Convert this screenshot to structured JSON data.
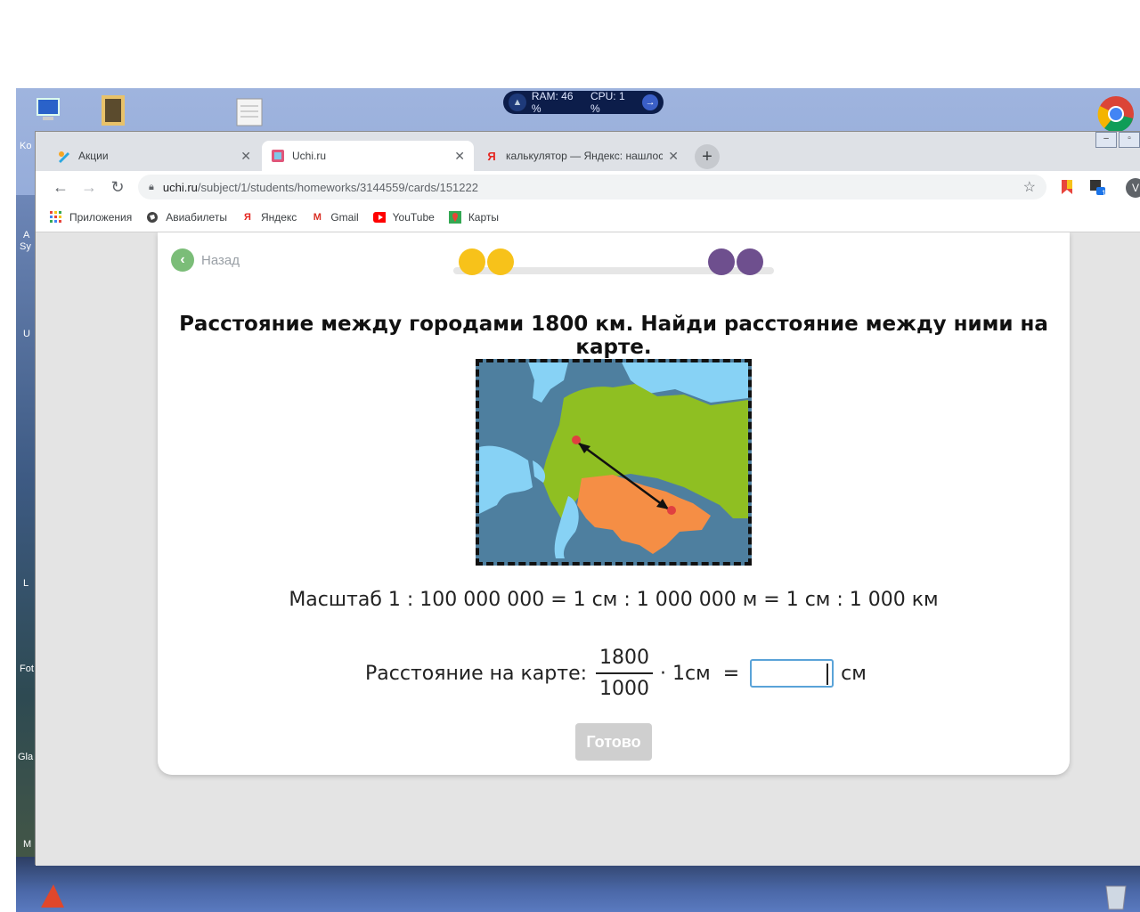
{
  "desktop": {
    "labels": [
      "Ko",
      "A",
      "Sy",
      "U",
      "L",
      "Fot",
      "Gla",
      "M"
    ],
    "sysmon": {
      "ram": "RAM: 46 %",
      "cpu": "CPU: 1 %"
    }
  },
  "browser": {
    "tabs": [
      {
        "title": "Акции",
        "icon": "uchi-pencil-icon"
      },
      {
        "title": "Uchi.ru",
        "icon": "uchi-favicon"
      },
      {
        "title": "калькулятор — Яндекс: нашлос",
        "icon": "yandex-icon"
      }
    ],
    "url": {
      "host": "uchi.ru",
      "path": "/subject/1/students/homeworks/3144559/cards/151222"
    },
    "profile_initial": "V",
    "ext_badge": "1",
    "bookmarks": [
      {
        "label": "Приложения",
        "icon": "apps-grid-icon"
      },
      {
        "label": "Авиабилеты",
        "icon": "globe-icon"
      },
      {
        "label": "Яндекс",
        "icon": "yandex-icon"
      },
      {
        "label": "Gmail",
        "icon": "gmail-icon"
      },
      {
        "label": "YouTube",
        "icon": "youtube-icon"
      },
      {
        "label": "Карты",
        "icon": "maps-icon"
      }
    ]
  },
  "page": {
    "back_label": "Назад",
    "progress": {
      "colors": {
        "done": "#f7c21a",
        "pending": "#6e4f8e",
        "track": "#e6e6e6"
      }
    },
    "question": "Расстояние между городами 1800 км. Найди расстояние между ними на карте.",
    "scale_text": "Масштаб 1 : 100 000 000 = 1 см : 1 000 000 м = 1 см : 1 000 км",
    "formula": {
      "label": "Расстояние на карте:",
      "numerator": "1800",
      "denominator": "1000",
      "multiplier": "· 1см",
      "equals": "=",
      "answer_value": "",
      "unit": "см"
    },
    "done_button": "Готово"
  }
}
